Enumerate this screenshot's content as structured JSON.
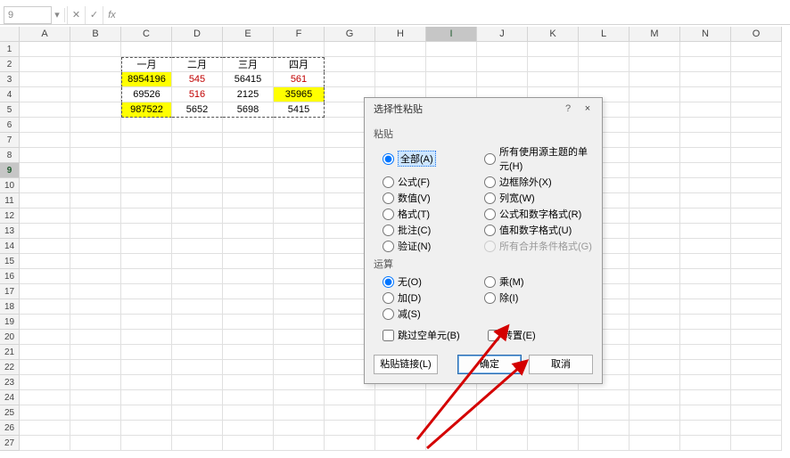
{
  "formula_bar": {
    "name_box": "9",
    "fx": "fx"
  },
  "columns": [
    "A",
    "B",
    "C",
    "D",
    "E",
    "F",
    "G",
    "H",
    "I",
    "J",
    "K",
    "L",
    "M",
    "N",
    "O"
  ],
  "row_nums": [
    1,
    2,
    3,
    4,
    5,
    6,
    7,
    8,
    9,
    10,
    11,
    12,
    13,
    14,
    15,
    16,
    17,
    18,
    19,
    20,
    21,
    22,
    23,
    24,
    25,
    26,
    27
  ],
  "selected_col": "I",
  "selected_row": 9,
  "table": {
    "header": [
      "一月",
      "二月",
      "三月",
      "四月"
    ],
    "rows": [
      {
        "c": "8954196",
        "d": "545",
        "e": "56415",
        "f": "561",
        "c_hl": true,
        "d_red": true,
        "f_red": true
      },
      {
        "c": "69526",
        "d": "516",
        "e": "2125",
        "f": "35965",
        "d_red": true,
        "f_hl": true
      },
      {
        "c": "987522",
        "d": "5652",
        "e": "5698",
        "f": "5415",
        "c_hl": true
      }
    ]
  },
  "dialog": {
    "title": "选择性粘贴",
    "help": "?",
    "close": "×",
    "paste_label": "粘贴",
    "paste_left": [
      "全部(A)",
      "公式(F)",
      "数值(V)",
      "格式(T)",
      "批注(C)",
      "验证(N)"
    ],
    "paste_right": [
      "所有使用源主题的单元(H)",
      "边框除外(X)",
      "列宽(W)",
      "公式和数字格式(R)",
      "值和数字格式(U)",
      "所有合并条件格式(G)"
    ],
    "op_label": "运算",
    "op_left": [
      "无(O)",
      "加(D)",
      "减(S)"
    ],
    "op_right": [
      "乘(M)",
      "除(I)"
    ],
    "skip_blanks": "跳过空单元(B)",
    "transpose": "转置(E)",
    "paste_link": "粘贴链接(L)",
    "ok": "确定",
    "cancel": "取消"
  }
}
